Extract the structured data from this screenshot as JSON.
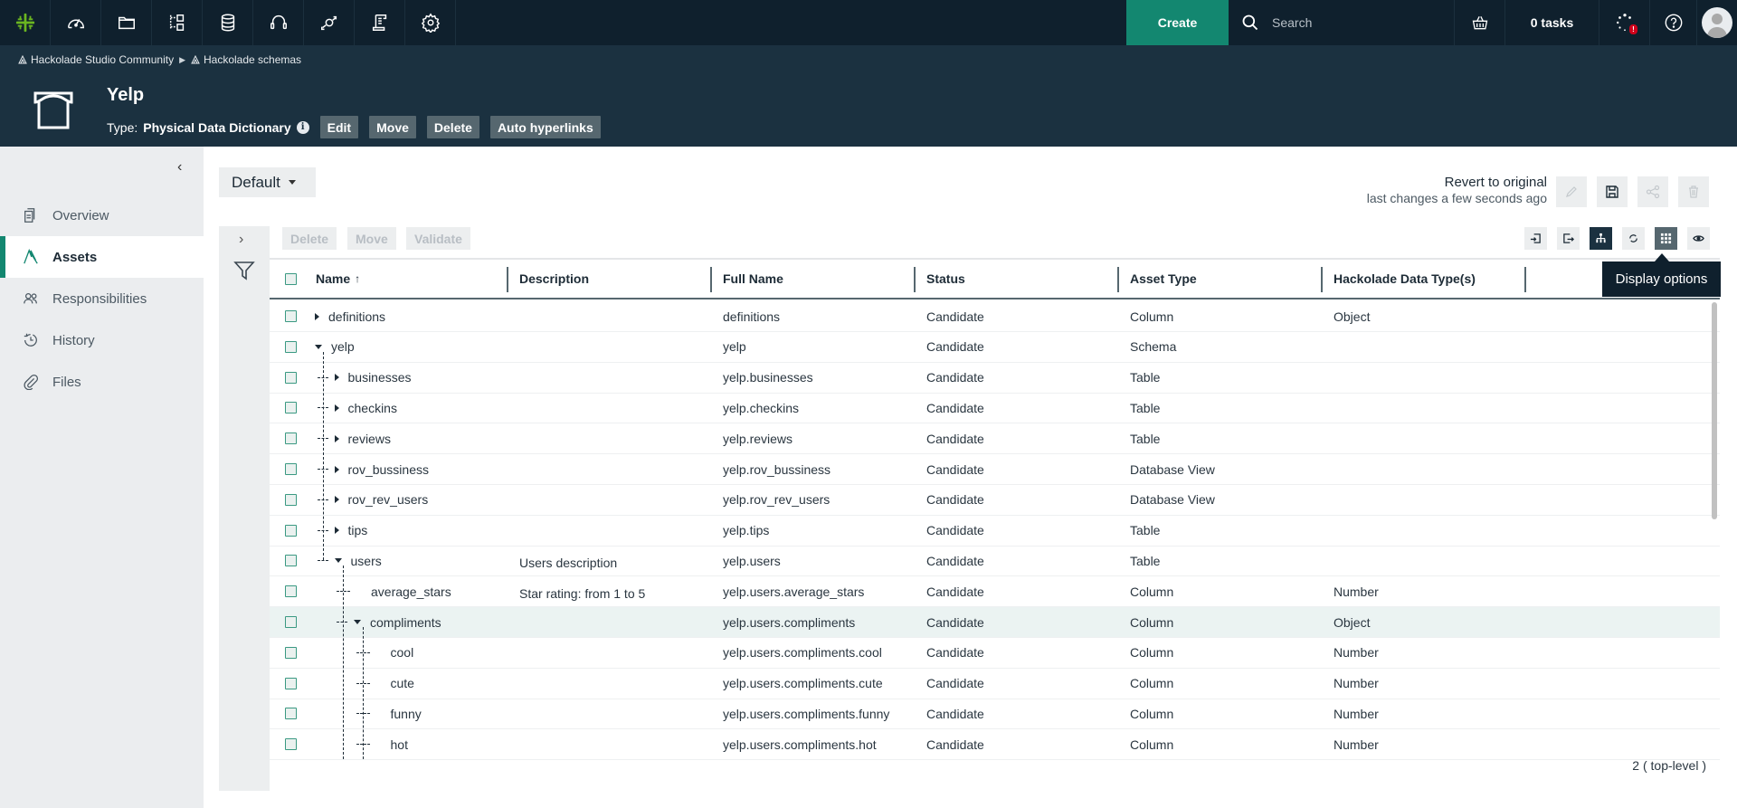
{
  "topnav": {
    "logo": "hackolade-logo-icon",
    "icons": [
      "dashboard-icon",
      "folder-icon",
      "hierarchy-icon",
      "database-icon",
      "headset-icon",
      "lineage-icon",
      "scroll-icon",
      "gear-icon"
    ],
    "create_label": "Create",
    "search_placeholder": "Search",
    "tasks_label": "0 tasks",
    "brand_color": "#138770"
  },
  "header": {
    "breadcrumb": [
      "Hackolade Studio Community",
      "Hackolade schemas"
    ],
    "title": "Yelp",
    "type_label": "Type:",
    "type_value": "Physical Data Dictionary",
    "buttons": [
      "Edit",
      "Move",
      "Delete",
      "Auto hyperlinks"
    ]
  },
  "sidebar": {
    "items": [
      {
        "label": "Overview",
        "icon": "document-icon",
        "active": false
      },
      {
        "label": "Assets",
        "icon": "assets-icon",
        "active": true
      },
      {
        "label": "Responsibilities",
        "icon": "people-icon",
        "active": false
      },
      {
        "label": "History",
        "icon": "history-icon",
        "active": false
      },
      {
        "label": "Files",
        "icon": "paperclip-icon",
        "active": false
      }
    ]
  },
  "main": {
    "view_select": "Default",
    "revert_label": "Revert to original",
    "last_changes": "last changes a few seconds ago",
    "actions": [
      "Delete",
      "Move",
      "Validate"
    ],
    "tooltip": "Display options",
    "footer_count": "2 ( top-level )"
  },
  "table": {
    "columns": [
      "Name",
      "Description",
      "Full Name",
      "Status",
      "Asset Type",
      "Hackolade Data Type(s)"
    ],
    "sort_indicator": "↑",
    "rows": [
      {
        "name": "definitions",
        "description": "",
        "full_name": "definitions",
        "status": "Candidate",
        "asset_type": "Column",
        "data_type": "Object"
      },
      {
        "name": "yelp",
        "description": "",
        "full_name": "yelp",
        "status": "Candidate",
        "asset_type": "Schema",
        "data_type": ""
      },
      {
        "name": "businesses",
        "description": "",
        "full_name": "yelp.businesses",
        "status": "Candidate",
        "asset_type": "Table",
        "data_type": ""
      },
      {
        "name": "checkins",
        "description": "",
        "full_name": "yelp.checkins",
        "status": "Candidate",
        "asset_type": "Table",
        "data_type": ""
      },
      {
        "name": "reviews",
        "description": "",
        "full_name": "yelp.reviews",
        "status": "Candidate",
        "asset_type": "Table",
        "data_type": ""
      },
      {
        "name": "rov_bussiness",
        "description": "",
        "full_name": "yelp.rov_bussiness",
        "status": "Candidate",
        "asset_type": "Database View",
        "data_type": ""
      },
      {
        "name": "rov_rev_users",
        "description": "",
        "full_name": "yelp.rov_rev_users",
        "status": "Candidate",
        "asset_type": "Database View",
        "data_type": ""
      },
      {
        "name": "tips",
        "description": "",
        "full_name": "yelp.tips",
        "status": "Candidate",
        "asset_type": "Table",
        "data_type": ""
      },
      {
        "name": "users",
        "description": "Users description",
        "full_name": "yelp.users",
        "status": "Candidate",
        "asset_type": "Table",
        "data_type": ""
      },
      {
        "name": "average_stars",
        "description": "Star rating: from 1 to 5",
        "full_name": "yelp.users.average_stars",
        "status": "Candidate",
        "asset_type": "Column",
        "data_type": "Number"
      },
      {
        "name": "compliments",
        "description": "",
        "full_name": "yelp.users.compliments",
        "status": "Candidate",
        "asset_type": "Column",
        "data_type": "Object"
      },
      {
        "name": "cool",
        "description": "",
        "full_name": "yelp.users.compliments.cool",
        "status": "Candidate",
        "asset_type": "Column",
        "data_type": "Number"
      },
      {
        "name": "cute",
        "description": "",
        "full_name": "yelp.users.compliments.cute",
        "status": "Candidate",
        "asset_type": "Column",
        "data_type": "Number"
      },
      {
        "name": "funny",
        "description": "",
        "full_name": "yelp.users.compliments.funny",
        "status": "Candidate",
        "asset_type": "Column",
        "data_type": "Number"
      },
      {
        "name": "hot",
        "description": "",
        "full_name": "yelp.users.compliments.hot",
        "status": "Candidate",
        "asset_type": "Column",
        "data_type": "Number"
      }
    ]
  }
}
